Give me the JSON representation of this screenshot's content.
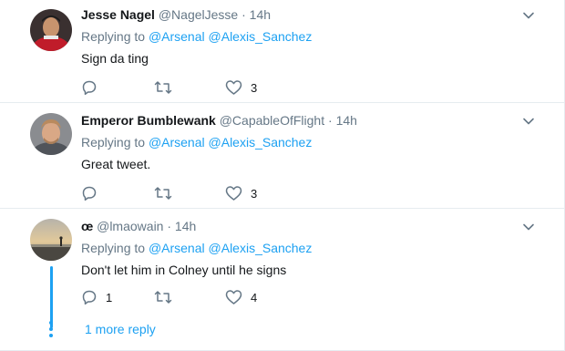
{
  "tweets": [
    {
      "fullname": "Jesse Nagel",
      "handle": "@NagelJesse",
      "dot": "·",
      "time": "14h",
      "replying_prefix": "Replying to",
      "mentions": [
        "@Arsenal",
        "@Alexis_Sanchez"
      ],
      "text": "Sign da ting",
      "reply_count": "",
      "retweet_count": "",
      "like_count": "3",
      "avatar_icon": "avatar-photo"
    },
    {
      "fullname": "Emperor Bumblewank",
      "handle": "@CapableOfFlight",
      "dot": "·",
      "time": "14h",
      "replying_prefix": "Replying to",
      "mentions": [
        "@Arsenal",
        "@Alexis_Sanchez"
      ],
      "text": "Great tweet.",
      "reply_count": "",
      "retweet_count": "",
      "like_count": "3",
      "avatar_icon": "avatar-photo"
    },
    {
      "fullname": "œ",
      "handle": "@lmaowain",
      "dot": "·",
      "time": "14h",
      "replying_prefix": "Replying to",
      "mentions": [
        "@Arsenal",
        "@Alexis_Sanchez"
      ],
      "text": "Don't let him in Colney until he signs",
      "reply_count": "1",
      "retweet_count": "",
      "like_count": "4",
      "avatar_icon": "avatar-photo"
    }
  ],
  "thread": {
    "more_replies_label": "1 more reply"
  },
  "icons": {
    "reply": "reply-icon",
    "retweet": "retweet-icon",
    "like": "heart-icon",
    "menu": "chevron-down-icon"
  },
  "colors": {
    "accent": "#1da1f2",
    "muted": "#657786",
    "text": "#14171a",
    "divider": "#e6ecf0"
  }
}
